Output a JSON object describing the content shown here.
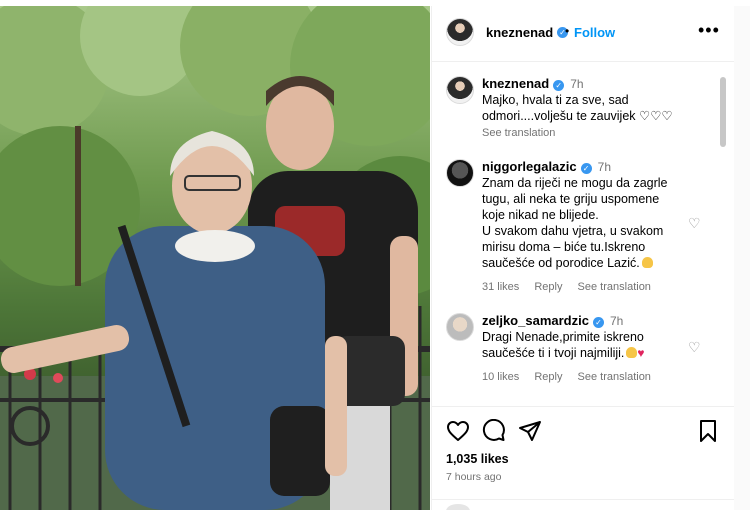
{
  "post": {
    "username": "kneznenad",
    "follow_label": "Follow",
    "more_icon": "more-horizontal-icon",
    "likes": "1,035 likes",
    "time_ago": "7 hours ago"
  },
  "comments": [
    {
      "username": "kneznenad",
      "time": "7h",
      "text": "Majko, hvala ti za sve, sad odmori....volješu te zauvijek ♡♡♡",
      "see_translation": "See translation"
    },
    {
      "username": "niggorlegalazic",
      "time": "7h",
      "text": "Znam da riječi ne mogu da zagrle tugu, ali neka te griju uspomene koje nikad ne blijede.\nU svakom dahu vjetra, u svakom mirisu doma – biće tu.Iskreno saučešće od porodice Lazić.",
      "likes": "31 likes",
      "reply": "Reply",
      "see_translation": "See translation"
    },
    {
      "username": "zeljko_samardzic",
      "time": "7h",
      "text": "Dragi Nenade,primite iskreno saučešće ti i tvoji najmiliji.",
      "likes": "10 likes",
      "reply": "Reply",
      "see_translation": "See translation"
    }
  ],
  "colors": {
    "accent_blue": "#0095f6",
    "verified_blue": "#3897f0",
    "muted_gray": "#737373"
  }
}
